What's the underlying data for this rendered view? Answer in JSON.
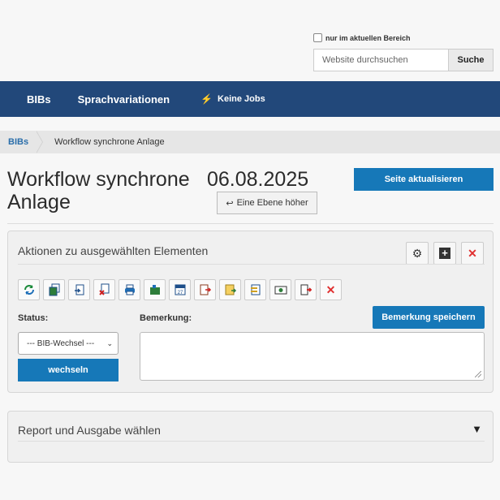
{
  "search": {
    "scope_label": "nur im aktuellen Bereich",
    "placeholder": "Website durchsuchen",
    "button": "Suche"
  },
  "nav": {
    "items": [
      {
        "label": "BIBs"
      },
      {
        "label": "Sprachvariationen"
      },
      {
        "label": "Keine Jobs",
        "icon": "bolt-icon"
      }
    ]
  },
  "breadcrumb": {
    "items": [
      "BIBs",
      "Workflow synchrone Anlage"
    ]
  },
  "header": {
    "title": "Workflow synchrone Anlage",
    "date": "06.08.2025",
    "up_button": "Eine Ebene höher",
    "refresh_button": "Seite aktualisieren"
  },
  "actions_panel": {
    "title": "Aktionen zu ausgewählten Elementen",
    "header_icons": [
      "gear-icon",
      "plus-square-icon",
      "close-icon"
    ],
    "toolbar_icons": [
      "refresh-icon",
      "copy-icon",
      "paste-icon",
      "delete-copy-icon",
      "print-icon",
      "folder-icon",
      "calendar-icon",
      "export-icon",
      "move-icon",
      "transfer-icon",
      "camera-icon",
      "forward-icon",
      "remove-icon"
    ],
    "calendar_number": "27",
    "status_label": "Status:",
    "status_value": "--- BIB-Wechsel ---",
    "switch_button": "wechseln",
    "remark_label": "Bemerkung:",
    "save_button": "Bemerkung speichern"
  },
  "report_panel": {
    "title": "Report und Ausgabe wählen"
  },
  "colors": {
    "navbar": "#22487a",
    "primary_button": "#1678b8",
    "link": "#2a6eaa",
    "danger": "#e03030"
  }
}
